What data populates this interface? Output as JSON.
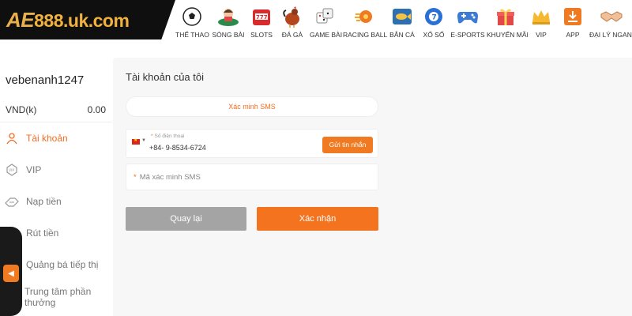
{
  "brand": {
    "prefix": "AE",
    "rest": "888.uk.com",
    "accent": "#f07a22",
    "logo_bg": "#0f0f0f"
  },
  "nav": [
    {
      "label": "THỂ THAO",
      "icon": "soccer-ball-icon"
    },
    {
      "label": "SÒNG BÀI",
      "icon": "casino-dealer-icon"
    },
    {
      "label": "SLOTS",
      "icon": "slot-machine-icon"
    },
    {
      "label": "ĐÁ GÀ",
      "icon": "rooster-icon"
    },
    {
      "label": "GAME BÀI",
      "icon": "dice-icon"
    },
    {
      "label": "RACING BALL",
      "icon": "racing-ball-icon"
    },
    {
      "label": "BẮN CÁ",
      "icon": "fish-icon"
    },
    {
      "label": "XỔ SỐ",
      "icon": "lottery-ball-icon"
    },
    {
      "label": "E-SPORTS",
      "icon": "gamepad-icon"
    },
    {
      "label": "KHUYẾN MÃI",
      "icon": "gift-icon"
    },
    {
      "label": "VIP",
      "icon": "crown-icon"
    },
    {
      "label": "APP",
      "icon": "download-icon"
    },
    {
      "label": "ĐẠI LÝ NGANG",
      "icon": "handshake-icon"
    }
  ],
  "sidebar": {
    "username": "vebenanh1247",
    "currency": "VND(k)",
    "balance": "0.00",
    "items": [
      {
        "label": "Tài khoản",
        "icon": "user-icon",
        "active": true
      },
      {
        "label": "VIP",
        "icon": "vip-icon",
        "active": false
      },
      {
        "label": "Nạp tiền",
        "icon": "deposit-icon",
        "active": false
      },
      {
        "label": "Rút tiền",
        "icon": "withdraw-icon",
        "active": false
      },
      {
        "label": "Quảng bá tiếp thị",
        "icon": "marketing-icon",
        "active": false
      },
      {
        "label": "Trung tâm phần thưởng",
        "icon": "reward-icon",
        "active": false
      }
    ]
  },
  "main": {
    "title": "Tài khoản của tôi",
    "tab_label": "Xác minh SMS",
    "phone": {
      "label": "Số điện thoại",
      "value": "+84- 9-8534-6724",
      "send_label": "Gửi tin nhắn"
    },
    "code": {
      "placeholder": "Mã xác minh SMS"
    },
    "back_label": "Quay lại",
    "confirm_label": "Xác nhận"
  }
}
